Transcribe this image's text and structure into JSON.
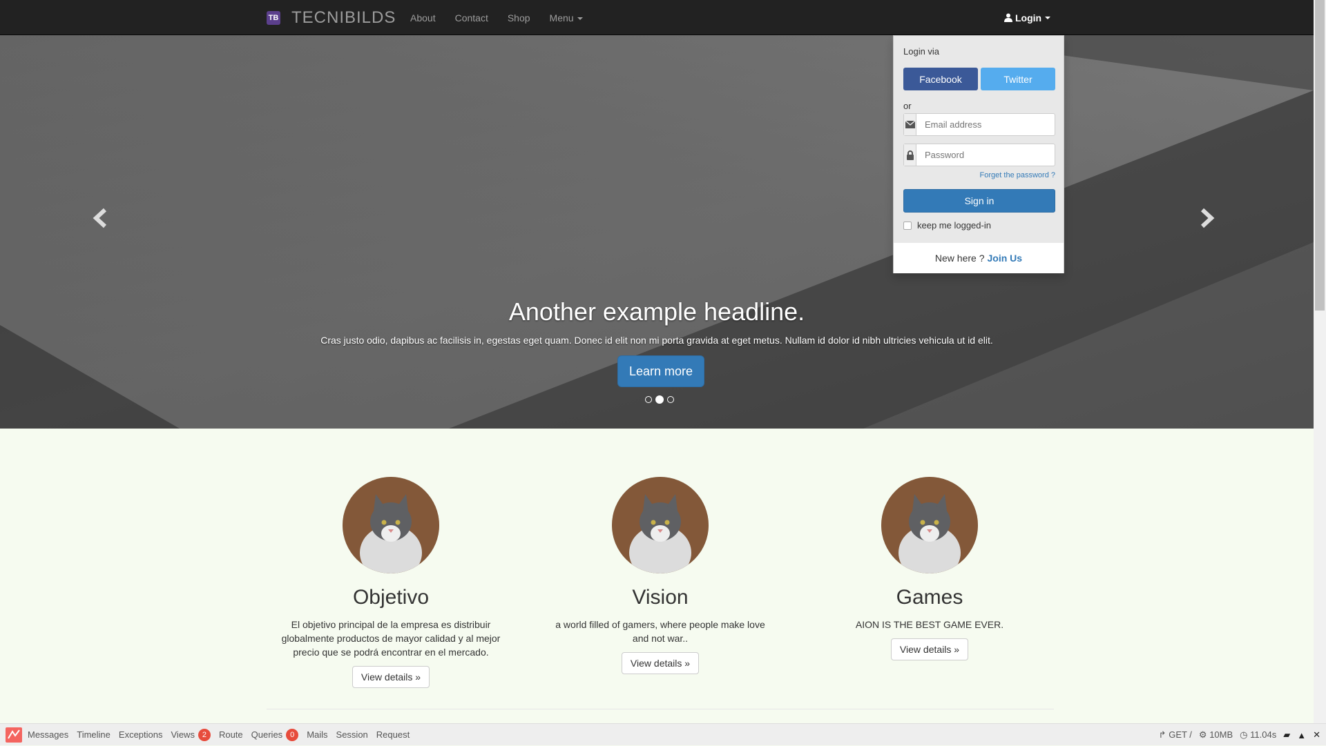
{
  "navbar": {
    "brand_badge": "TB",
    "brand_name": "TECNIBILDS",
    "links": [
      "About",
      "Contact",
      "Shop"
    ],
    "menu_label": "Menu",
    "login_label": "Login"
  },
  "hero": {
    "headline": "Another example headline.",
    "text": "Cras justo odio, dapibus ac facilisis in, egestas eget quam. Donec id elit non mi porta gravida at eget metus. Nullam id dolor id nibh ultricies vehicula ut id elit.",
    "button": "Learn more",
    "prev": "‹",
    "next": "›",
    "active_slide": 2,
    "slides": 3
  },
  "login": {
    "via": "Login via",
    "facebook": "Facebook",
    "twitter": "Twitter",
    "or": "or",
    "email_placeholder": "Email address",
    "password_placeholder": "Password",
    "forgot": "Forget the password ?",
    "signin": "Sign in",
    "keep": "keep me logged-in",
    "new_here": "New here ?",
    "join": "Join Us"
  },
  "features": [
    {
      "title": "Objetivo",
      "text": "El objetivo principal de la empresa es distribuir globalmente productos de mayor calidad y al mejor precio que se podrá encontrar en el mercado.",
      "button": "View details »"
    },
    {
      "title": "Vision",
      "text": "a world filled of gamers, where people make love and not war..",
      "button": "View details »"
    },
    {
      "title": "Games",
      "text": "AION IS THE BEST GAME EVER.",
      "button": "View details »"
    }
  ],
  "debugbar": {
    "tabs": [
      {
        "label": "Messages"
      },
      {
        "label": "Timeline"
      },
      {
        "label": "Exceptions"
      },
      {
        "label": "Views",
        "badge": "2"
      },
      {
        "label": "Route"
      },
      {
        "label": "Queries",
        "badge": "0"
      },
      {
        "label": "Mails"
      },
      {
        "label": "Session"
      },
      {
        "label": "Request"
      }
    ],
    "method": "GET /",
    "memory": "10MB",
    "time": "11.04s"
  },
  "colors": {
    "navbar": "#222222",
    "primary": "#337ab7",
    "facebook": "#3b5998",
    "twitter": "#55acee",
    "brand_badge": "#5b3f8c",
    "page_bg": "#f6fbf0"
  }
}
